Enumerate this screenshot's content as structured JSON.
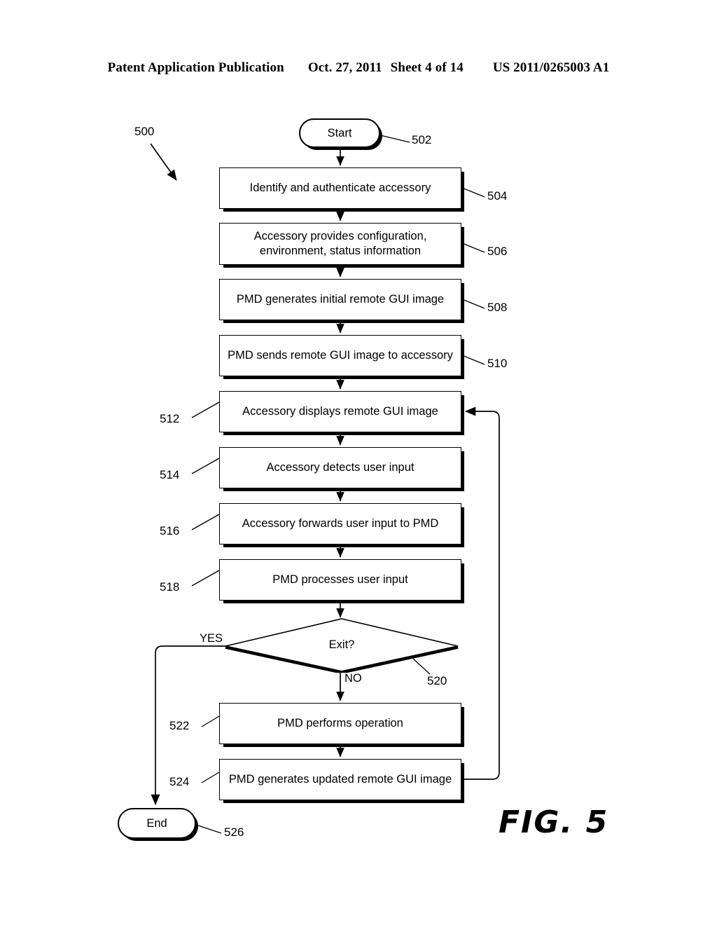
{
  "header": {
    "publication": "Patent Application Publication",
    "date": "Oct. 27, 2011",
    "sheet": "Sheet 4 of 14",
    "number": "US 2011/0265003 A1"
  },
  "figure": {
    "caption": "FIG. 5",
    "diagram_ref": "500"
  },
  "flowchart": {
    "type": "flowchart",
    "nodes": [
      {
        "id": "502",
        "shape": "terminator",
        "label": "Start"
      },
      {
        "id": "504",
        "shape": "process",
        "label": "Identify and authenticate accessory"
      },
      {
        "id": "506",
        "shape": "process",
        "label": "Accessory provides configuration, environment, status information"
      },
      {
        "id": "508",
        "shape": "process",
        "label": "PMD generates initial remote GUI image"
      },
      {
        "id": "510",
        "shape": "process",
        "label": "PMD sends remote GUI image to accessory"
      },
      {
        "id": "512",
        "shape": "process",
        "label": "Accessory displays remote GUI image"
      },
      {
        "id": "514",
        "shape": "process",
        "label": "Accessory detects user input"
      },
      {
        "id": "516",
        "shape": "process",
        "label": "Accessory forwards user input to PMD"
      },
      {
        "id": "518",
        "shape": "process",
        "label": "PMD processes user input"
      },
      {
        "id": "520",
        "shape": "decision",
        "label": "Exit?"
      },
      {
        "id": "522",
        "shape": "process",
        "label": "PMD performs operation"
      },
      {
        "id": "524",
        "shape": "process",
        "label": "PMD generates updated remote GUI image"
      },
      {
        "id": "526",
        "shape": "terminator",
        "label": "End"
      }
    ],
    "branch_labels": {
      "yes": "YES",
      "no": "NO"
    },
    "edges": [
      {
        "from": "502",
        "to": "504",
        "label": ""
      },
      {
        "from": "504",
        "to": "506",
        "label": ""
      },
      {
        "from": "506",
        "to": "508",
        "label": ""
      },
      {
        "from": "508",
        "to": "510",
        "label": ""
      },
      {
        "from": "510",
        "to": "512",
        "label": ""
      },
      {
        "from": "512",
        "to": "514",
        "label": ""
      },
      {
        "from": "514",
        "to": "516",
        "label": ""
      },
      {
        "from": "516",
        "to": "518",
        "label": ""
      },
      {
        "from": "518",
        "to": "520",
        "label": ""
      },
      {
        "from": "520",
        "to": "526",
        "label": "YES"
      },
      {
        "from": "520",
        "to": "522",
        "label": "NO"
      },
      {
        "from": "522",
        "to": "524",
        "label": ""
      },
      {
        "from": "524",
        "to": "512",
        "label": ""
      }
    ]
  }
}
